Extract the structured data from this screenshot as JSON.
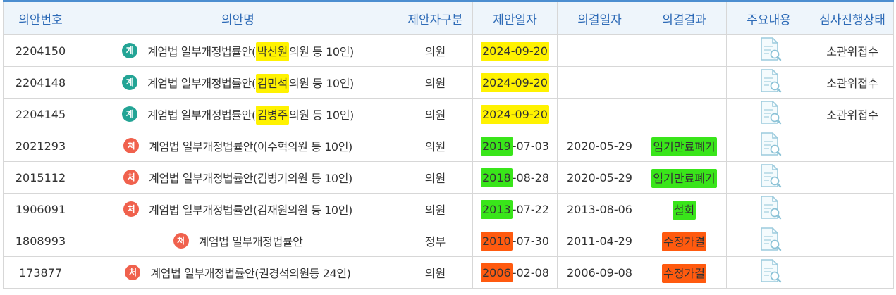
{
  "columns": [
    "의안번호",
    "의안명",
    "제안자구분",
    "제안일자",
    "의결일자",
    "의결결과",
    "주요내용",
    "심사진행상태"
  ],
  "status_badges": {
    "pending": {
      "label": "계",
      "color": "#23a495"
    },
    "done": {
      "label": "처",
      "color": "#f0614d"
    }
  },
  "highlight_colors": {
    "yellow": "#fff200",
    "green": "#39e51a",
    "orange": "#ff5a0f"
  },
  "icon": "document-search-icon",
  "rows": [
    {
      "bill_no": "2204150",
      "badge": "pending",
      "title_parts": [
        {
          "t": "계엄법 일부개정법률안("
        },
        {
          "t": "박선원",
          "hl": "yellow"
        },
        {
          "t": "의원 등 10인)"
        }
      ],
      "proposer": "의원",
      "proposed_date_parts": [
        {
          "t": "2024-09-20",
          "hl": "yellow"
        }
      ],
      "decision_date": "",
      "result_parts": [],
      "status": "소관위접수"
    },
    {
      "bill_no": "2204148",
      "badge": "pending",
      "title_parts": [
        {
          "t": "계엄법 일부개정법률안("
        },
        {
          "t": "김민석",
          "hl": "yellow"
        },
        {
          "t": "의원 등 10인)"
        }
      ],
      "proposer": "의원",
      "proposed_date_parts": [
        {
          "t": "2024-09-20",
          "hl": "yellow"
        }
      ],
      "decision_date": "",
      "result_parts": [],
      "status": "소관위접수"
    },
    {
      "bill_no": "2204145",
      "badge": "pending",
      "title_parts": [
        {
          "t": "계엄법 일부개정법률안("
        },
        {
          "t": "김병주",
          "hl": "yellow"
        },
        {
          "t": "의원 등 10인)"
        }
      ],
      "proposer": "의원",
      "proposed_date_parts": [
        {
          "t": "2024-09-20",
          "hl": "yellow"
        }
      ],
      "decision_date": "",
      "result_parts": [],
      "status": "소관위접수"
    },
    {
      "bill_no": "2021293",
      "badge": "done",
      "title_parts": [
        {
          "t": "계엄법 일부개정법률안(이수혁의원 등 10인)"
        }
      ],
      "proposer": "의원",
      "proposed_date_parts": [
        {
          "t": "2019",
          "hl": "green"
        },
        {
          "t": "-07-03"
        }
      ],
      "decision_date": "2020-05-29",
      "result_parts": [
        {
          "t": "임기만료폐기",
          "hl": "green"
        }
      ],
      "status": ""
    },
    {
      "bill_no": "2015112",
      "badge": "done",
      "title_parts": [
        {
          "t": "계엄법 일부개정법률안(김병기의원 등 10인)"
        }
      ],
      "proposer": "의원",
      "proposed_date_parts": [
        {
          "t": "2018",
          "hl": "green"
        },
        {
          "t": "-08-28"
        }
      ],
      "decision_date": "2020-05-29",
      "result_parts": [
        {
          "t": "임기만료폐기",
          "hl": "green"
        }
      ],
      "status": ""
    },
    {
      "bill_no": "1906091",
      "badge": "done",
      "title_parts": [
        {
          "t": "계엄법 일부개정법률안(김재원의원 등 10인)"
        }
      ],
      "proposer": "의원",
      "proposed_date_parts": [
        {
          "t": "2013",
          "hl": "green"
        },
        {
          "t": "-07-22"
        }
      ],
      "decision_date": "2013-08-06",
      "result_parts": [
        {
          "t": "철회",
          "hl": "green"
        }
      ],
      "status": ""
    },
    {
      "bill_no": "1808993",
      "badge": "done",
      "title_parts": [
        {
          "t": "계엄법 일부개정법률안"
        }
      ],
      "proposer": "정부",
      "proposed_date_parts": [
        {
          "t": "2010",
          "hl": "orange"
        },
        {
          "t": "-07-30"
        }
      ],
      "decision_date": "2011-04-29",
      "result_parts": [
        {
          "t": "수정가결",
          "hl": "orange"
        }
      ],
      "status": ""
    },
    {
      "bill_no": "173877",
      "badge": "done",
      "title_parts": [
        {
          "t": "계엄법 일부개정법률안(권경석의원등 24인)"
        }
      ],
      "proposer": "의원",
      "proposed_date_parts": [
        {
          "t": "2006",
          "hl": "orange"
        },
        {
          "t": "-02-08"
        }
      ],
      "decision_date": "2006-09-08",
      "result_parts": [
        {
          "t": "수정가결",
          "hl": "orange"
        }
      ],
      "status": ""
    }
  ]
}
